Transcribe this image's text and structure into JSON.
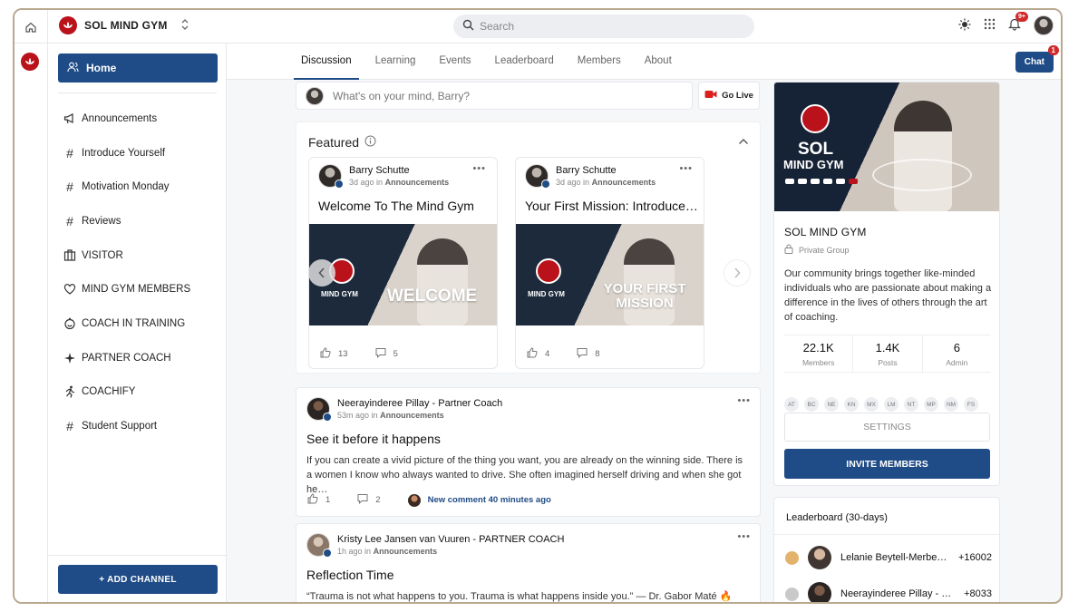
{
  "app": {
    "brand_name": "SOL MIND GYM"
  },
  "search": {
    "placeholder": "Search"
  },
  "topbar": {
    "notifications_badge": "9+"
  },
  "sidebar": {
    "home_label": "Home",
    "items": [
      {
        "label": "Announcements",
        "icon": "megaphone-icon"
      },
      {
        "label": "Introduce Yourself",
        "icon": "hash-icon"
      },
      {
        "label": "Motivation Monday",
        "icon": "hash-icon"
      },
      {
        "label": "Reviews",
        "icon": "hash-icon"
      },
      {
        "label": "VISITOR",
        "icon": "building-icon"
      },
      {
        "label": "MIND GYM MEMBERS",
        "icon": "heart-hand-icon"
      },
      {
        "label": "COACH IN TRAINING",
        "icon": "smile-icon"
      },
      {
        "label": "PARTNER COACH",
        "icon": "sparkle-person-icon"
      },
      {
        "label": "COACHIFY",
        "icon": "runner-icon"
      },
      {
        "label": "Student Support",
        "icon": "hash-icon"
      }
    ],
    "add_channel_label": "+ ADD CHANNEL"
  },
  "tabs": [
    "Discussion",
    "Learning",
    "Events",
    "Leaderboard",
    "Members",
    "About"
  ],
  "chat": {
    "label": "Chat",
    "badge": "1"
  },
  "composer": {
    "placeholder": "What's on your mind, Barry?",
    "go_live_label": "Go Live"
  },
  "featured": {
    "title": "Featured",
    "cards": [
      {
        "author": "Barry Schutte",
        "time": "3d ago",
        "in_word": "in",
        "channel": "Announcements",
        "title": "Welcome To The Mind Gym",
        "image_logo_text": "MIND GYM",
        "image_big_text": "WELCOME",
        "likes": "13",
        "comments": "5"
      },
      {
        "author": "Barry Schutte",
        "time": "3d ago",
        "in_word": "in",
        "channel": "Announcements",
        "title": "Your First Mission: Introduce…",
        "image_logo_text": "MIND GYM",
        "image_big_text": "YOUR FIRST MISSION",
        "likes": "4",
        "comments": "8"
      }
    ]
  },
  "posts": [
    {
      "author": "Neerayinderee Pillay - Partner Coach",
      "time": "53m ago",
      "in_word": "in",
      "channel": "Announcements",
      "title": "See it before it happens",
      "body": "If you can create a vivid picture of the thing you want, you are already on the winning side. There is a women I know who always wanted to drive. She often imagined herself driving and when she got he…",
      "likes": "1",
      "comments": "2",
      "new_comment": "New comment 40 minutes ago"
    },
    {
      "author": "Kristy Lee Jansen van Vuuren - PARTNER COACH",
      "time": "1h ago",
      "in_word": "in",
      "channel": "Announcements",
      "title": "Reflection Time",
      "body": "“Trauma is not what happens to you. Trauma is what happens inside you.” — Dr. Gabor Maté 🔥 What"
    }
  ],
  "group": {
    "hero_sol": "SOL",
    "hero_mind_gym": "MIND GYM",
    "name": "SOL MIND GYM",
    "privacy": "Private Group",
    "description": "Our community brings together like-minded individuals who are passionate about making a difference in the lives of others through the art of coaching.",
    "stats": [
      {
        "value": "22.1K",
        "label": "Members"
      },
      {
        "value": "1.4K",
        "label": "Posts"
      },
      {
        "value": "6",
        "label": "Admin"
      }
    ],
    "member_initials": [
      "AT",
      "BC",
      "NE",
      "KN",
      "MX",
      "LM",
      "NT",
      "MP",
      "NM",
      "FS"
    ],
    "settings_label": "SETTINGS",
    "invite_label": "INVITE MEMBERS"
  },
  "leaderboard": {
    "title": "Leaderboard (30-days)",
    "rows": [
      {
        "name": "Lelanie Beytell-Merbe…",
        "points": "+16002"
      },
      {
        "name": "Neerayinderee Pillay - …",
        "points": "+8033"
      }
    ]
  },
  "colors": {
    "primary": "#1f4b86",
    "brand_red": "#b9121b",
    "badge_red": "#d02a2a"
  }
}
